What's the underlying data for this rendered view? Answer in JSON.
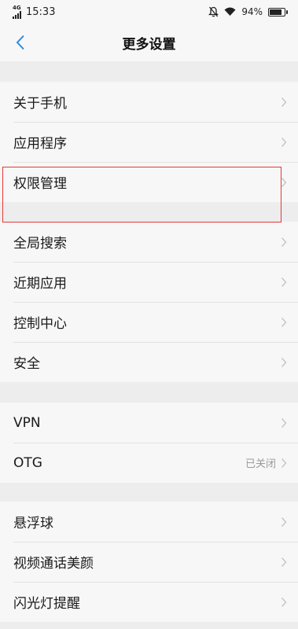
{
  "status_bar": {
    "network": "4G",
    "time": "15:33",
    "battery_percent": "94%",
    "battery_level": 0.94
  },
  "header": {
    "title": "更多设置",
    "back_icon": "chevron-left-icon"
  },
  "groups": [
    {
      "items": [
        {
          "label": "关于手机",
          "value": ""
        },
        {
          "label": "应用程序",
          "value": ""
        },
        {
          "label": "权限管理",
          "value": ""
        }
      ]
    },
    {
      "items": [
        {
          "label": "全局搜索",
          "value": ""
        },
        {
          "label": "近期应用",
          "value": ""
        },
        {
          "label": "控制中心",
          "value": ""
        },
        {
          "label": "安全",
          "value": ""
        }
      ]
    },
    {
      "items": [
        {
          "label": "VPN",
          "value": ""
        },
        {
          "label": "OTG",
          "value": "已关闭"
        }
      ]
    },
    {
      "items": [
        {
          "label": "悬浮球",
          "value": ""
        },
        {
          "label": "视频通话美颜",
          "value": ""
        },
        {
          "label": "闪光灯提醒",
          "value": ""
        }
      ]
    }
  ],
  "colors": {
    "accent": "#2f8cd8",
    "highlight": "#e53935",
    "background": "#ededed",
    "surface": "#f7f7f7"
  }
}
